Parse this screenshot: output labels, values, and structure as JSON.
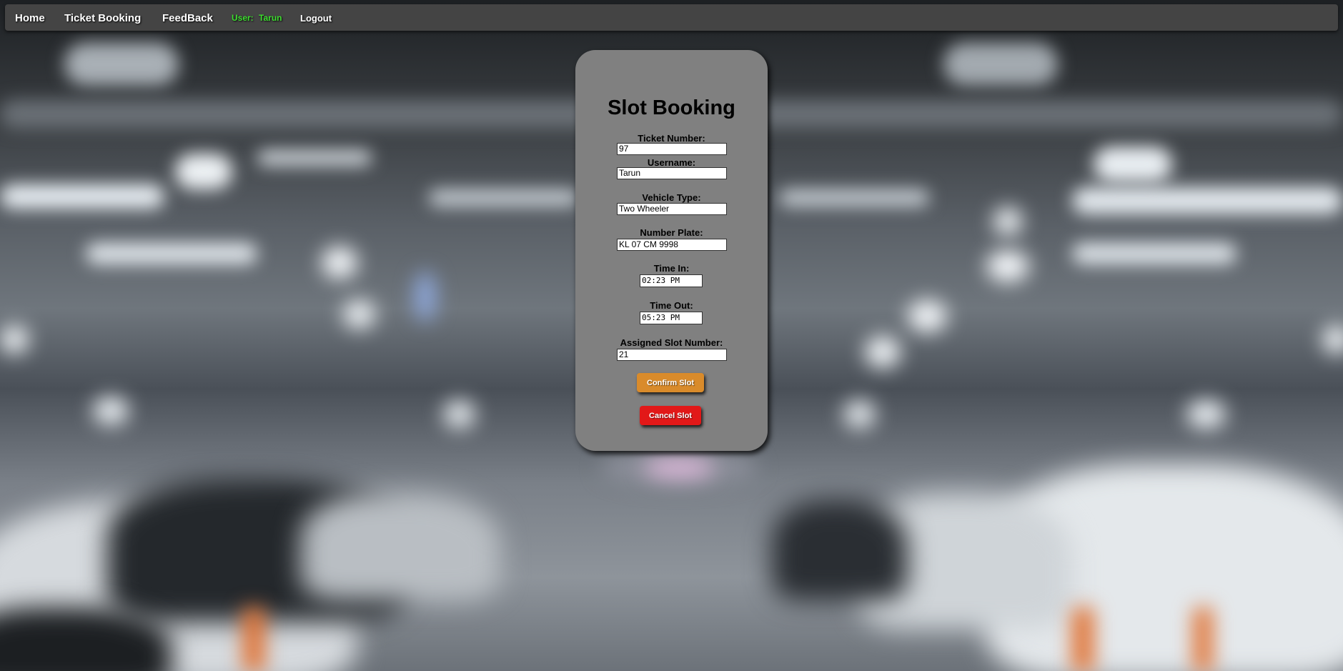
{
  "navbar": {
    "home": "Home",
    "ticket_booking": "Ticket Booking",
    "feedback": "FeedBack",
    "user_label": "User:",
    "user_name": "Tarun",
    "logout": "Logout"
  },
  "form": {
    "title": "Slot Booking",
    "ticket_number": {
      "label": "Ticket Number:",
      "value": "97"
    },
    "username": {
      "label": "Username:",
      "value": "Tarun"
    },
    "vehicle_type": {
      "label": "Vehicle Type:",
      "value": "Two Wheeler"
    },
    "number_plate": {
      "label": "Number Plate:",
      "value": "KL 07 CM 9998"
    },
    "time_in": {
      "label": "Time In:",
      "value": "02:23 PM"
    },
    "time_out": {
      "label": "Time Out:",
      "value": "05:23 PM"
    },
    "slot_number": {
      "label": "Assigned Slot Number:",
      "value": "21"
    },
    "confirm_button": "Confirm Slot",
    "cancel_button": "Cancel Slot"
  },
  "colors": {
    "navbar_bg": "#444444",
    "card_bg": "#808080",
    "user_green": "#3ddc2f",
    "confirm_orange": "#d98b2b",
    "cancel_red": "#e21818"
  }
}
